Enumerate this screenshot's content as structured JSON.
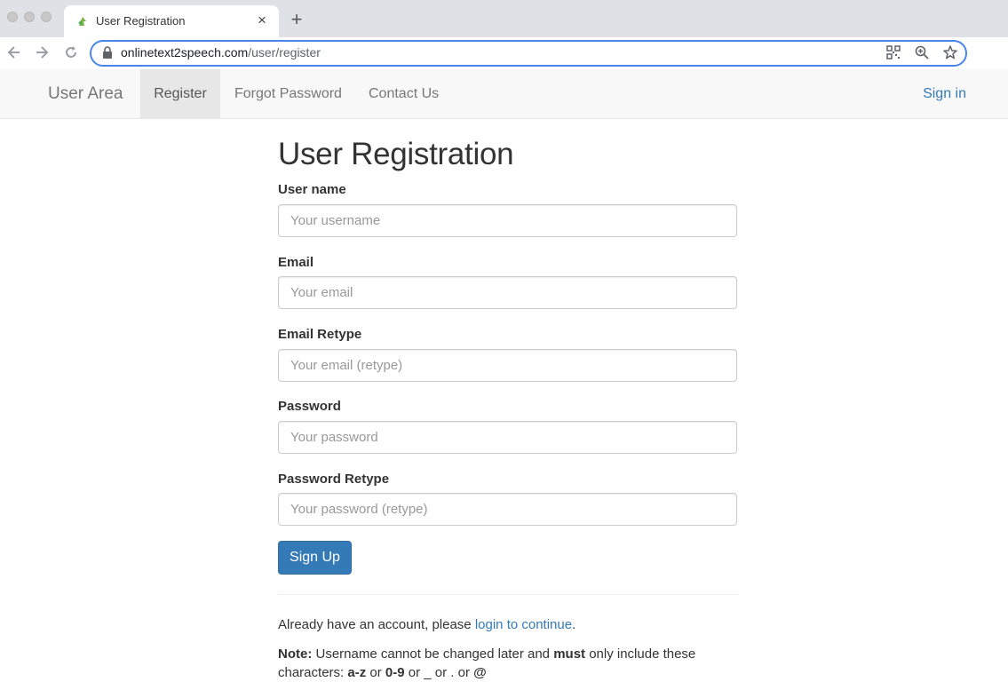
{
  "browser": {
    "tab_title": "User Registration",
    "tab_close": "×",
    "new_tab": "+",
    "url_domain": "onlinetext2speech.com",
    "url_path": "/user/register"
  },
  "navbar": {
    "brand": "User Area",
    "items": [
      {
        "label": "Register",
        "active": true
      },
      {
        "label": "Forgot Password"
      },
      {
        "label": "Contact Us"
      }
    ],
    "sign_in": "Sign in"
  },
  "form": {
    "title": "User Registration",
    "fields": [
      {
        "label": "User name",
        "placeholder": "Your username"
      },
      {
        "label": "Email",
        "placeholder": "Your email"
      },
      {
        "label": "Email Retype",
        "placeholder": "Your email (retype)"
      },
      {
        "label": "Password",
        "placeholder": "Your password"
      },
      {
        "label": "Password Retype",
        "placeholder": "Your password (retype)"
      }
    ],
    "submit": "Sign Up"
  },
  "footer": {
    "already_prefix": "Already have an account, please ",
    "login_link": "login to continue",
    "already_suffix": ".",
    "note_label": "Note:",
    "note_text1": " Username cannot be changed later and ",
    "note_must": "must",
    "note_text2": " only include these characters: ",
    "chars_az": "a-z",
    "or1": " or ",
    "chars_09": "0-9",
    "or2": " or _ or . or ",
    "chars_at": "@"
  }
}
